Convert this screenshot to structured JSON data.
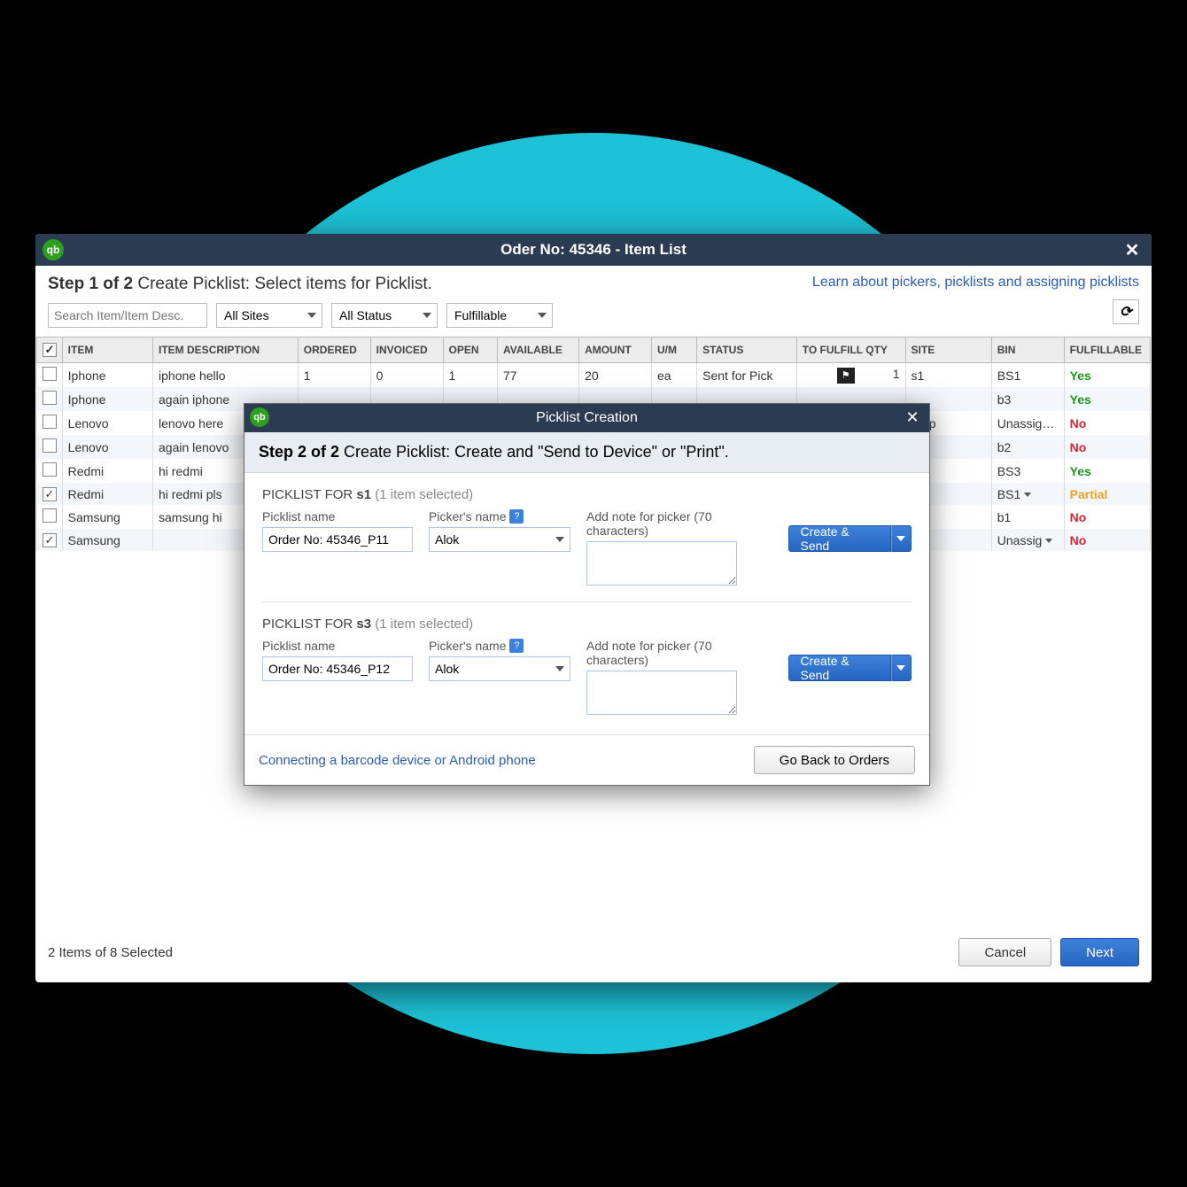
{
  "window": {
    "title": "Oder No: 45346 - Item List",
    "logo_text": "qb",
    "step_bold": "Step 1 of 2",
    "step_rest": " Create Picklist: Select items for Picklist.",
    "learn_link": "Learn about pickers, picklists and assigning picklists"
  },
  "filters": {
    "search_placeholder": "Search Item/Item Desc.",
    "sites": "All Sites",
    "status": "All Status",
    "fulfillable": "Fulfillable"
  },
  "columns": [
    "ITEM",
    "ITEM DESCRIPTION",
    "ORDERED",
    "INVOICED",
    "OPEN",
    "AVAILABLE",
    "AMOUNT",
    "U/M",
    "STATUS",
    "TO FULFILL QTY",
    "SITE",
    "BIN",
    "FULFILLABLE"
  ],
  "rows": [
    {
      "checked": false,
      "item": "Iphone",
      "desc": "iphone hello",
      "ordered": "1",
      "invoiced": "0",
      "open": "1",
      "available": "77",
      "amount": "20",
      "um": "ea",
      "status": "Sent for Pick",
      "qty": "1",
      "flag": true,
      "site": "s1",
      "bin": "BS1",
      "fulfill": "Yes",
      "fclass": "yes"
    },
    {
      "checked": false,
      "item": "Iphone",
      "desc": "again iphone",
      "ordered": "",
      "invoiced": "",
      "open": "",
      "available": "",
      "amount": "",
      "um": "",
      "status": "",
      "qty": "",
      "flag": false,
      "site": "",
      "bin": "b3",
      "fulfill": "Yes",
      "fclass": "yes"
    },
    {
      "checked": false,
      "item": "Lenovo",
      "desc": "lenovo here",
      "ordered": "",
      "invoiced": "",
      "open": "",
      "available": "",
      "amount": "",
      "um": "",
      "status": "",
      "qty": "",
      "flag": false,
      "site": "Ship",
      "bin": "Unassig…",
      "fulfill": "No",
      "fclass": "no"
    },
    {
      "checked": false,
      "item": "Lenovo",
      "desc": "again lenovo",
      "ordered": "",
      "invoiced": "",
      "open": "",
      "available": "",
      "amount": "",
      "um": "",
      "status": "",
      "qty": "",
      "flag": false,
      "site": "",
      "bin": "b2",
      "fulfill": "No",
      "fclass": "no"
    },
    {
      "checked": false,
      "item": "Redmi",
      "desc": "hi redmi",
      "ordered": "",
      "invoiced": "",
      "open": "",
      "available": "",
      "amount": "",
      "um": "",
      "status": "",
      "qty": "",
      "flag": false,
      "site": "",
      "bin": "BS3",
      "fulfill": "Yes",
      "fclass": "yes"
    },
    {
      "checked": true,
      "item": "Redmi",
      "desc": "hi redmi pls",
      "ordered": "",
      "invoiced": "",
      "open": "",
      "available": "",
      "amount": "",
      "um": "",
      "status": "",
      "qty": "",
      "flag": false,
      "site": "",
      "sitecaret": true,
      "bin": "BS1",
      "bincaret": true,
      "fulfill": "Partial",
      "fclass": "partial"
    },
    {
      "checked": false,
      "item": "Samsung",
      "desc": "samsung hi",
      "ordered": "",
      "invoiced": "",
      "open": "",
      "available": "",
      "amount": "",
      "um": "",
      "status": "",
      "qty": "",
      "flag": false,
      "site": "",
      "bin": "b1",
      "fulfill": "No",
      "fclass": "no"
    },
    {
      "checked": true,
      "item": "Samsung",
      "desc": "",
      "ordered": "",
      "invoiced": "",
      "open": "",
      "available": "",
      "amount": "",
      "um": "",
      "status": "",
      "qty": "",
      "flag": false,
      "site": "",
      "sitecaret": true,
      "bin": "Unassig",
      "bincaret": true,
      "fulfill": "No",
      "fclass": "no"
    }
  ],
  "footer": {
    "status": "2 Items of 8 Selected",
    "cancel": "Cancel",
    "next": "Next"
  },
  "modal": {
    "title": "Picklist Creation",
    "logo_text": "qb",
    "step_bold": "Step 2 of 2",
    "step_rest": " Create Picklist: Create and \"Send to Device\" or \"Print\".",
    "groups": [
      {
        "title_prefix": "PICKLIST FOR ",
        "title_bold": "s1",
        "selected": " (1 item selected)",
        "name_label": "Picklist name",
        "name_value": "Order No: 45346_P11",
        "picker_label": "Picker's name",
        "picker_value": "Alok",
        "note_label": "Add note for picker (70 characters)",
        "create_label": "Create & Send"
      },
      {
        "title_prefix": "PICKLIST FOR ",
        "title_bold": "s3",
        "selected": " (1 item selected)",
        "name_label": "Picklist name",
        "name_value": "Order No: 45346_P12",
        "picker_label": "Picker's name",
        "picker_value": "Alok",
        "note_label": "Add note for picker (70 characters)",
        "create_label": "Create & Send"
      }
    ],
    "connect_link": "Connecting a barcode device or Android phone",
    "go_back": "Go Back to Orders"
  }
}
